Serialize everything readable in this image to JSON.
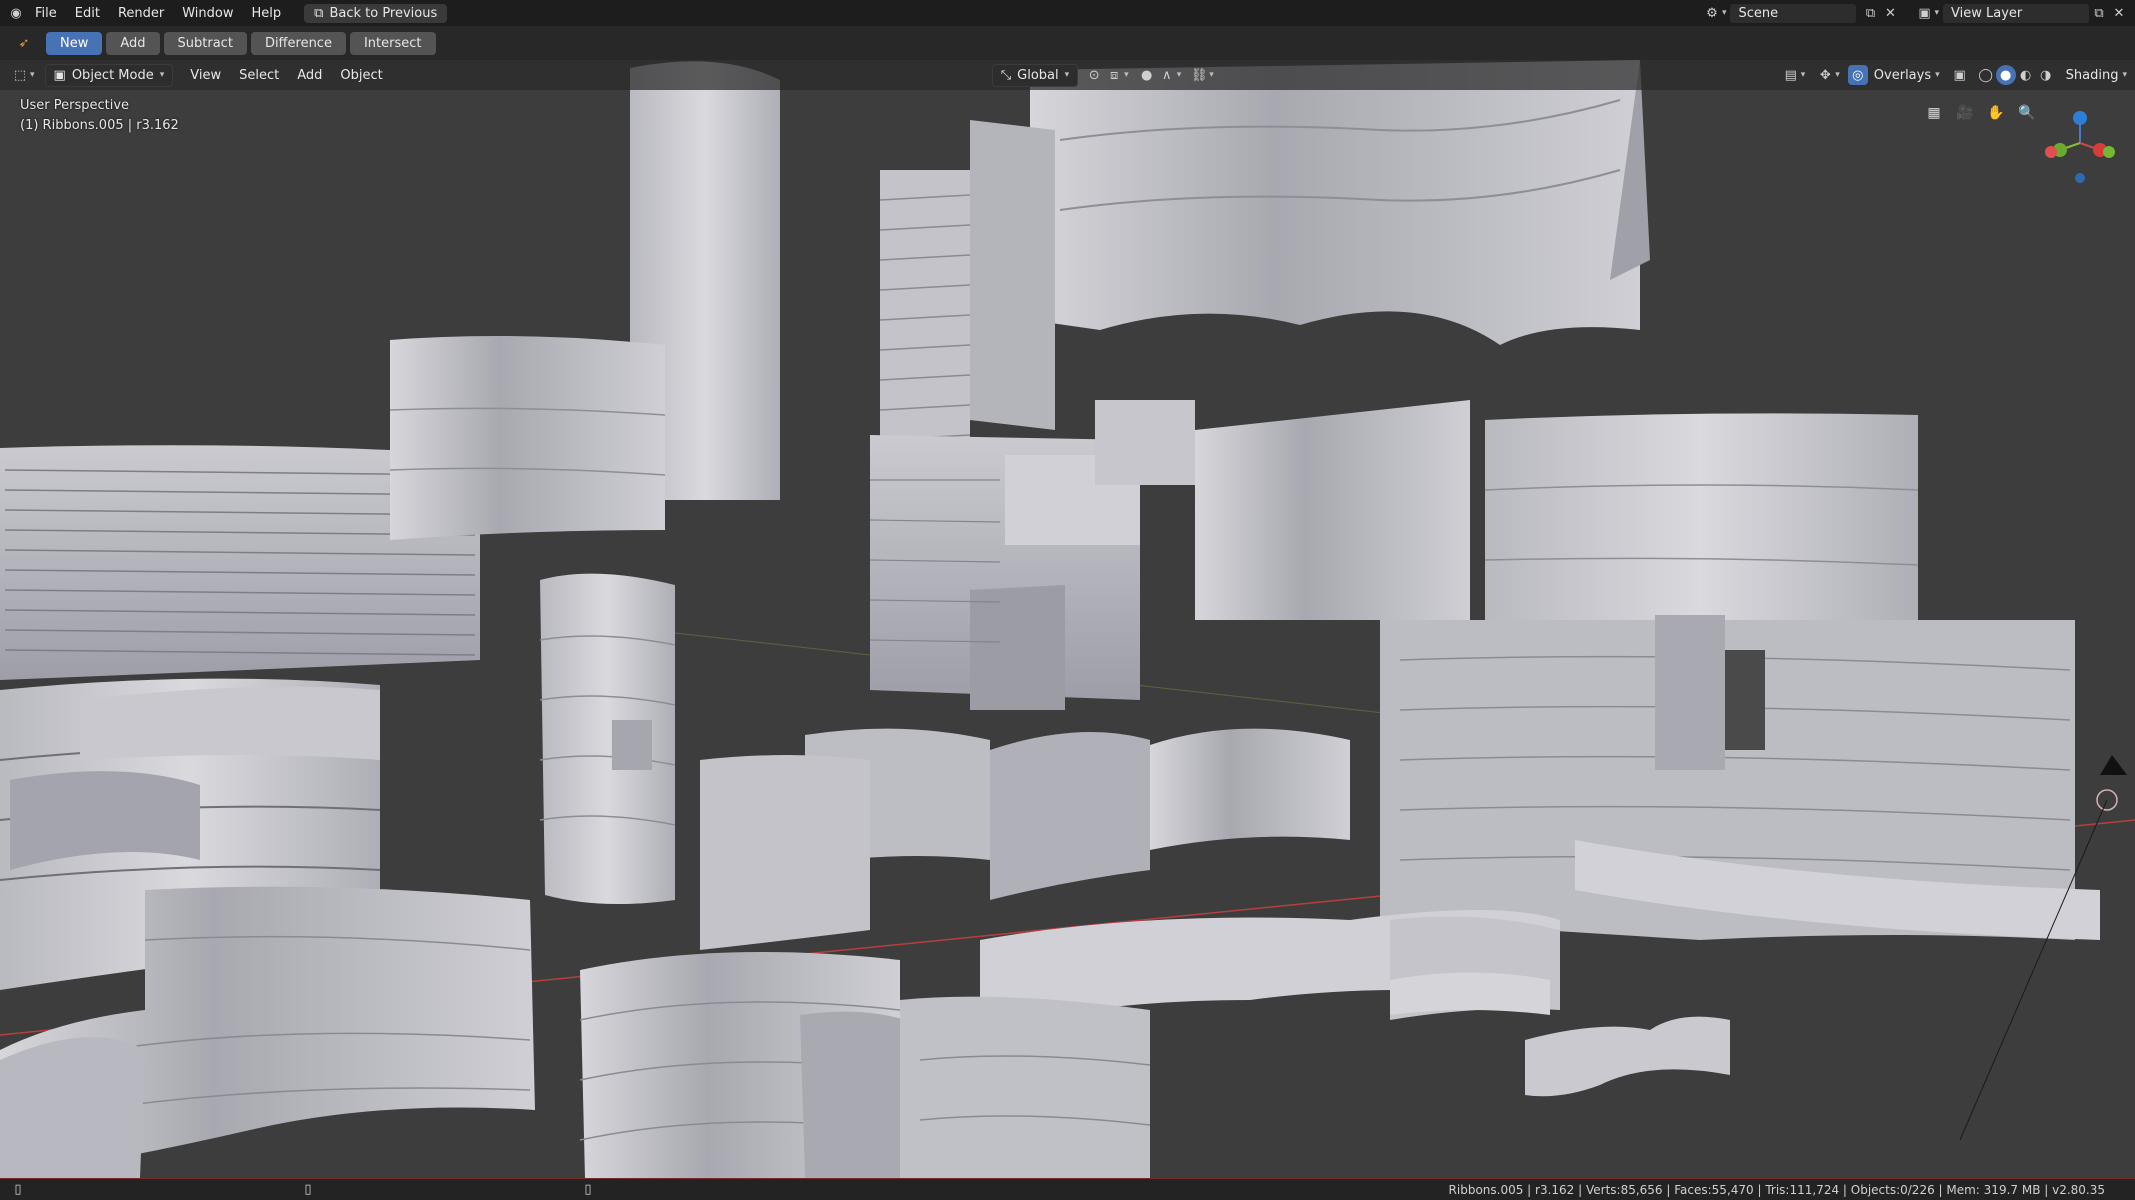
{
  "topbar": {
    "menus": [
      "File",
      "Edit",
      "Render",
      "Window",
      "Help"
    ],
    "back_button": "Back to Previous",
    "scene_label": "Scene",
    "view_layer_label": "View Layer"
  },
  "toolbar": {
    "buttons": [
      "New",
      "Add",
      "Subtract",
      "Difference",
      "Intersect"
    ],
    "active": "New"
  },
  "viewport_header": {
    "mode": "Object Mode",
    "menus": [
      "View",
      "Select",
      "Add",
      "Object"
    ],
    "transform_orientation": "Global",
    "overlays_label": "Overlays",
    "shading_label": "Shading"
  },
  "viewport": {
    "perspective_label": "User Perspective",
    "object_label": "(1) Ribbons.005 | r3.162",
    "gizmo_axes": [
      "X",
      "Y",
      "Z"
    ]
  },
  "status": {
    "text": "Ribbons.005 | r3.162 | Verts:85,656 | Faces:55,470 | Tris:111,724 | Objects:0/226 | Mem: 319.7 MB | v2.80.35"
  },
  "colors": {
    "accent": "#4772b3",
    "viewport_bg": "#3d3d3d",
    "mesh": "#c9c9cf",
    "x_axis": "#b54040"
  }
}
